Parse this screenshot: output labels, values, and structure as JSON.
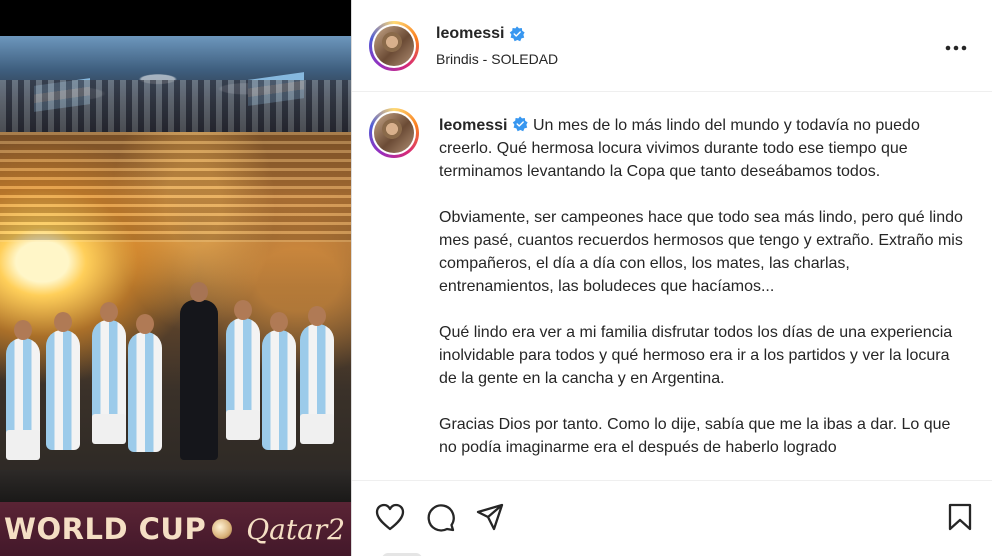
{
  "media": {
    "banner_left": "WORLD CUP",
    "banner_right": "Qatar2"
  },
  "header": {
    "username": "leomessi",
    "location": "Brindis - SOLEDAD",
    "more_icon": "more-horizontal-icon",
    "verified_icon": "verified-badge-icon",
    "verified_color": "#3897f0"
  },
  "caption": {
    "username": "leomessi",
    "paragraph_1": "Un mes de lo más lindo del mundo y todavía no puedo creerlo. Qué hermosa locura vivimos durante todo ese tiempo que terminamos levantando la Copa que tanto deseábamos todos.",
    "paragraph_2": "Obviamente, ser campeones hace que todo sea más lindo, pero qué lindo mes pasé, cuantos recuerdos hermosos que tengo y extraño. Extraño mis compañeros, el día a día con ellos, los mates, las charlas, entrenamientos, las boludeces que hacíamos...",
    "paragraph_3": "Qué lindo era ver a mi familia disfrutar todos los días de una experiencia inolvidable para todos y qué hermoso era ir a los partidos y ver la locura de la gente en la cancha y en Argentina.",
    "paragraph_4": "Gracias Dios por tanto. Como lo dije, sabía que me la ibas a dar. Lo que no podía imaginarme era el después de haberlo logrado"
  },
  "actions": {
    "like_icon": "heart-icon",
    "comment_icon": "comment-icon",
    "share_icon": "send-icon",
    "save_icon": "bookmark-icon"
  }
}
